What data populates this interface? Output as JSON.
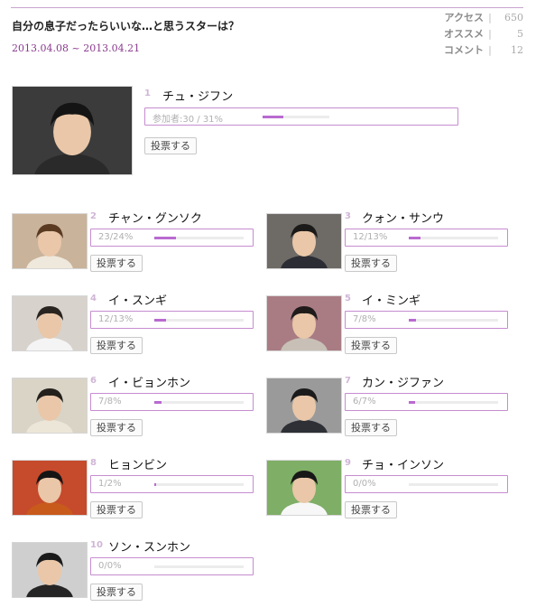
{
  "header": {
    "title": "自分の息子だったらいいな…と思うスターは？",
    "period": "2013.04.08 ~ 2013.04.21"
  },
  "stats": [
    {
      "label": "アクセス",
      "value": "650"
    },
    {
      "label": "オススメ",
      "value": "5"
    },
    {
      "label": "コメント",
      "value": "12"
    }
  ],
  "vote_label": "投票する",
  "bar_accent": "#b96ad0",
  "candidates": [
    {
      "rank": "1",
      "name": "チュ・ジフン",
      "bar_text": "参加者:30 / 31%",
      "share": 0.31
    },
    {
      "rank": "2",
      "name": "チャン・グンソク",
      "bar_text": "23/24%",
      "share": 0.24
    },
    {
      "rank": "3",
      "name": "クォン・サンウ",
      "bar_text": "12/13%",
      "share": 0.13
    },
    {
      "rank": "4",
      "name": "イ・スンギ",
      "bar_text": "12/13%",
      "share": 0.13
    },
    {
      "rank": "5",
      "name": "イ・ミンギ",
      "bar_text": "7/8%",
      "share": 0.08
    },
    {
      "rank": "6",
      "name": "イ・ビョンホン",
      "bar_text": "7/8%",
      "share": 0.08
    },
    {
      "rank": "7",
      "name": "カン・ジファン",
      "bar_text": "6/7%",
      "share": 0.07
    },
    {
      "rank": "8",
      "name": "ヒョンビン",
      "bar_text": "1/2%",
      "share": 0.02
    },
    {
      "rank": "9",
      "name": "チョ・インソン",
      "bar_text": "0/0%",
      "share": 0.0
    },
    {
      "rank": "10",
      "name": "ソン・スンホン",
      "bar_text": "0/0%",
      "share": 0.0
    }
  ]
}
